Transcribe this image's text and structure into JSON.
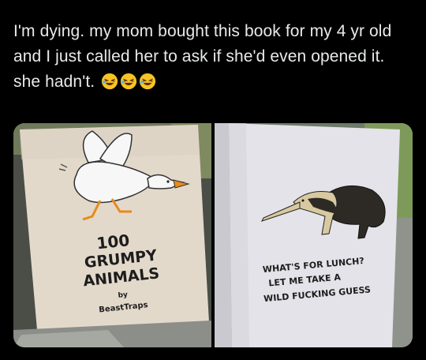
{
  "tweet": {
    "text": "I'm dying. my mom bought this book for my 4 yr old and I just called her to ask if she'd even opened it. she hadn't.",
    "emojis": [
      "rolling-on-floor-laughing",
      "rolling-on-floor-laughing",
      "rolling-on-floor-laughing"
    ]
  },
  "photos": {
    "cover": {
      "title_line1": "100",
      "title_line2": "GRUMPY",
      "title_line3": "ANIMALS",
      "by": "by",
      "author": "BeastTraps"
    },
    "page": {
      "caption_line1": "WHAT'S FOR LUNCH?",
      "caption_line2": "LET ME TAKE A",
      "caption_line3": "WILD FUCKING GUESS"
    }
  }
}
